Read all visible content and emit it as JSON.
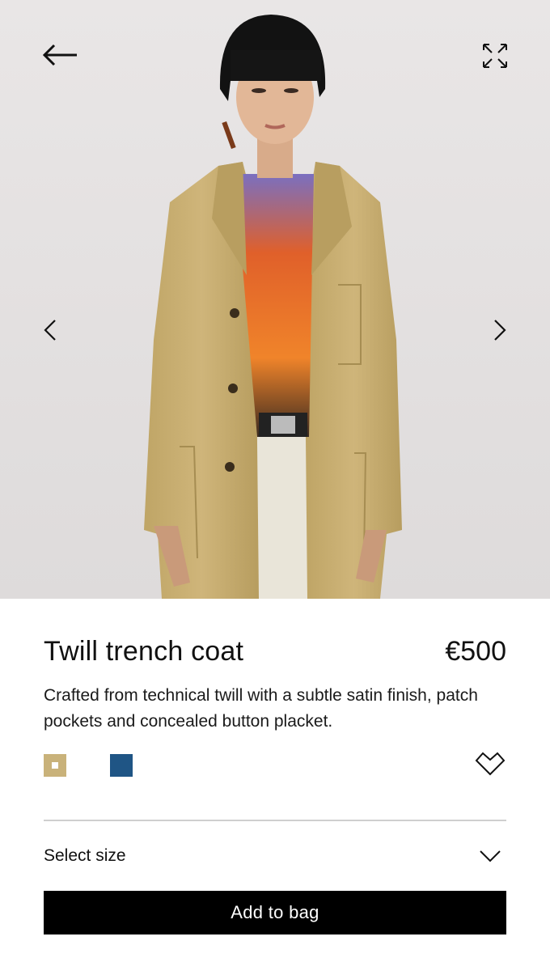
{
  "hero": {
    "image_alt": "Model wearing beige twill trench coat over graphic t-shirt"
  },
  "nav": {
    "back_icon": "arrow-left-icon",
    "expand_icon": "expand-icon",
    "prev_icon": "chevron-left-icon",
    "next_icon": "chevron-right-icon"
  },
  "product": {
    "title": "Twill trench coat",
    "price": "€500",
    "description": "Crafted from technical twill with a subtle satin finish, patch pockets and concealed button placket.",
    "colors": [
      {
        "hex": "#c9b27a",
        "selected": true
      },
      {
        "hex": "#1f5585",
        "selected": false
      }
    ],
    "wishlist_icon": "heart-icon"
  },
  "size": {
    "label": "Select size",
    "icon": "chevron-down-icon"
  },
  "cta": {
    "add_label": "Add to bag"
  },
  "colors": {
    "background": "#ffffff",
    "text": "#111111",
    "button": "#000000",
    "button_text": "#ffffff",
    "divider": "#cfcfcf"
  }
}
